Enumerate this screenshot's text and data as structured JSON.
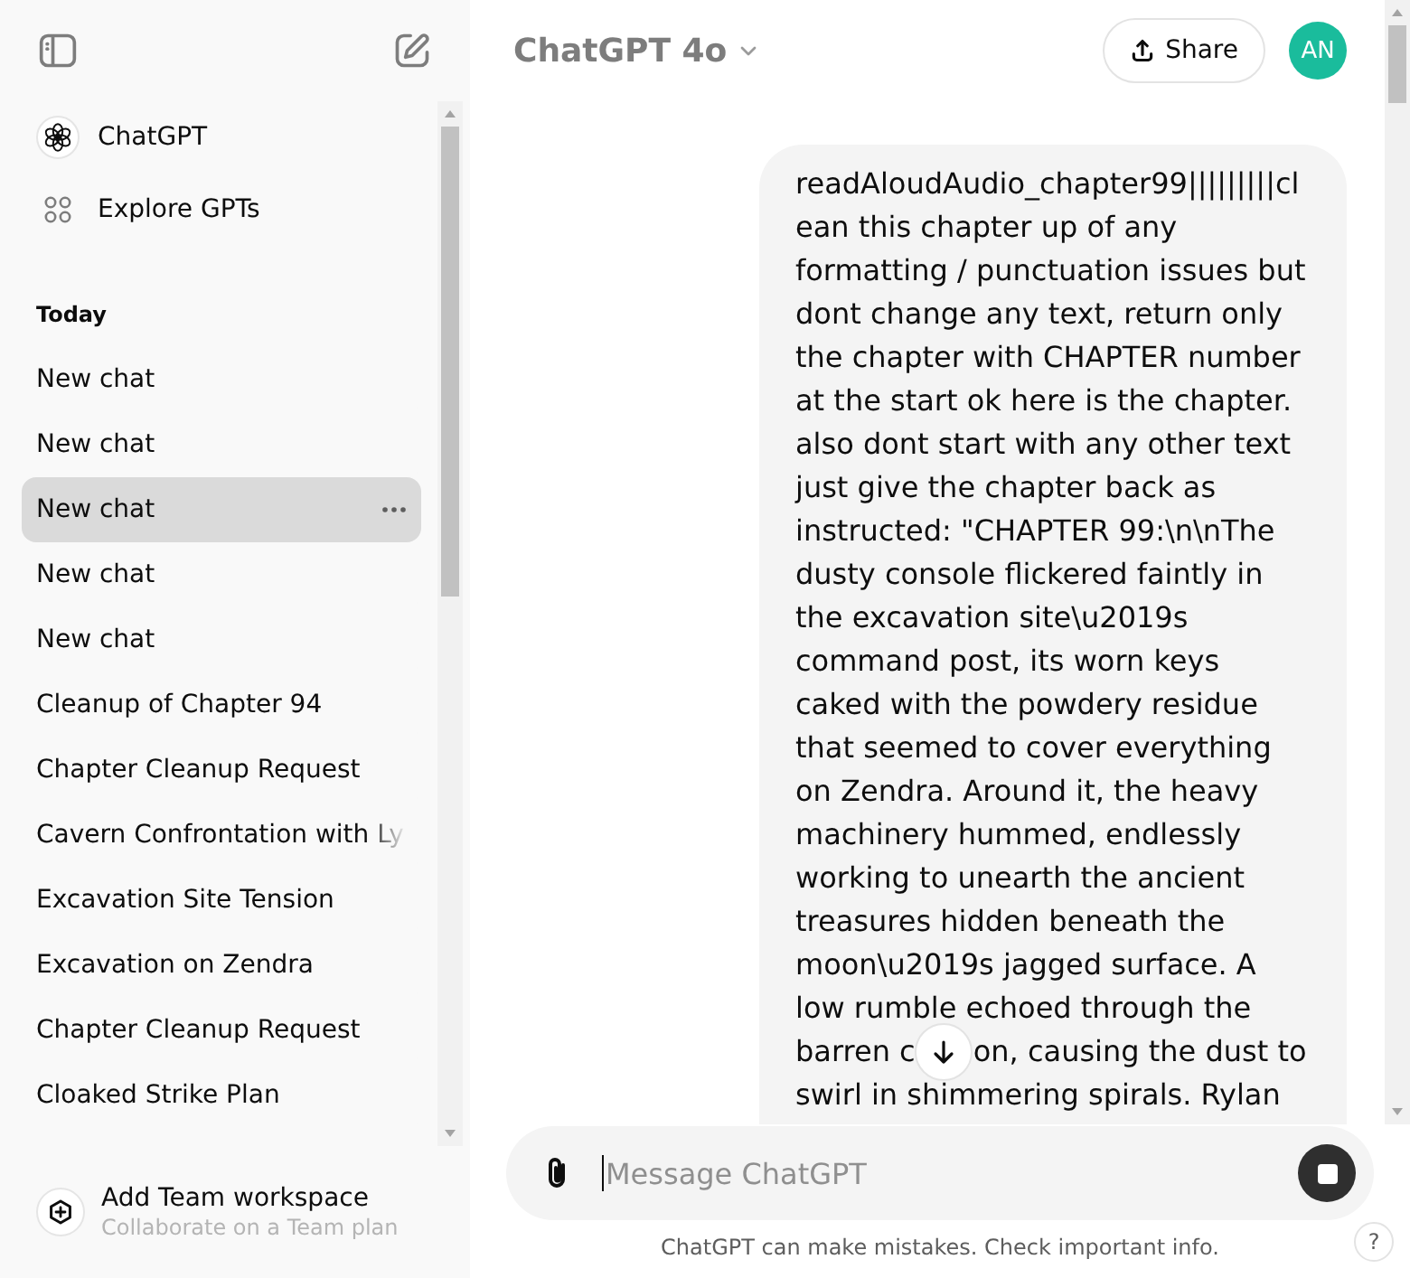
{
  "sidebar": {
    "nav": [
      {
        "kind": "model",
        "label": "ChatGPT"
      },
      {
        "kind": "explore",
        "label": "Explore GPTs"
      }
    ],
    "sections": [
      {
        "title": "Today",
        "chats": [
          {
            "title": "New chat",
            "selected": false
          },
          {
            "title": "New chat",
            "selected": false
          },
          {
            "title": "New chat",
            "selected": true
          },
          {
            "title": "New chat",
            "selected": false
          },
          {
            "title": "New chat",
            "selected": false
          },
          {
            "title": "Cleanup of Chapter 94",
            "selected": false
          },
          {
            "title": "Chapter Cleanup Request",
            "selected": false
          },
          {
            "title": "Cavern Confrontation with Ly",
            "selected": false
          },
          {
            "title": "Excavation Site Tension",
            "selected": false
          },
          {
            "title": "Excavation on Zendra",
            "selected": false
          },
          {
            "title": "Chapter Cleanup Request",
            "selected": false
          },
          {
            "title": "Cloaked Strike Plan",
            "selected": false
          }
        ]
      }
    ],
    "footer": {
      "title": "Add Team workspace",
      "subtitle": "Collaborate on a Team plan"
    }
  },
  "header": {
    "model": "ChatGPT 4o",
    "share": "Share",
    "avatar": "AN"
  },
  "message": {
    "parts": [
      "readAloudAudio_chapter99|||||||||clean this chapter up of any formatting / punctuation issues but dont change any text, return only the chapter with CHAPTER number at the start ok here is the chapter. also dont start with any other text just give the chapter back as instructed: \"CHAPTER 99:\\n\\nThe dusty console flickered faintly in the excavation site\\u2019s command post, its worn keys caked with the powdery residue that seemed to cover everything on Zendra. Around it, the heavy machinery hummed, endlessly working to unearth the ancient treasures hidden beneath the moon\\u2019s jagged surface. A low rumble echoed through the barren c",
      "on, causing the dust to swirl in shimmering spirals. Rylan"
    ]
  },
  "composer": {
    "placeholder": "Message ChatGPT"
  },
  "disclaimer": "ChatGPT can make mistakes. Check important info.",
  "help": "?"
}
